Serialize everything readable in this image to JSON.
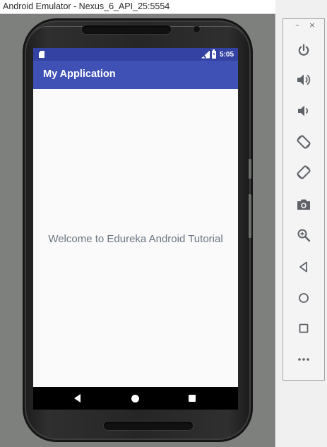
{
  "window": {
    "title": "Android Emulator - Nexus_6_API_25:5554"
  },
  "status_bar": {
    "time": "5:05",
    "icons": [
      "sd-card-icon",
      "signal-icon",
      "battery-charging-icon"
    ]
  },
  "app": {
    "title": "My Application",
    "message": "Welcome to Edureka Android Tutorial"
  },
  "nav_bar": {
    "buttons": [
      "back",
      "home",
      "recents"
    ]
  },
  "toolbar": {
    "minimize_label": "–",
    "close_label": "×",
    "buttons": [
      {
        "id": "power",
        "icon": "power-icon"
      },
      {
        "id": "volume-up",
        "icon": "volume-up-icon"
      },
      {
        "id": "volume-down",
        "icon": "volume-down-icon"
      },
      {
        "id": "rotate-left",
        "icon": "rotate-left-icon"
      },
      {
        "id": "rotate-right",
        "icon": "rotate-right-icon"
      },
      {
        "id": "screenshot",
        "icon": "camera-icon"
      },
      {
        "id": "zoom",
        "icon": "zoom-icon"
      },
      {
        "id": "back",
        "icon": "back-triangle-icon"
      },
      {
        "id": "home",
        "icon": "home-circle-icon"
      },
      {
        "id": "overview",
        "icon": "overview-square-icon"
      },
      {
        "id": "more",
        "icon": "more-icon"
      }
    ],
    "icon_color": "#5f6368"
  },
  "colors": {
    "status_bar": "#3443a3",
    "app_bar": "#3f51b5",
    "content_background": "#fafafa",
    "message_text": "#6b7480",
    "emulator_background": "#7e807e"
  }
}
